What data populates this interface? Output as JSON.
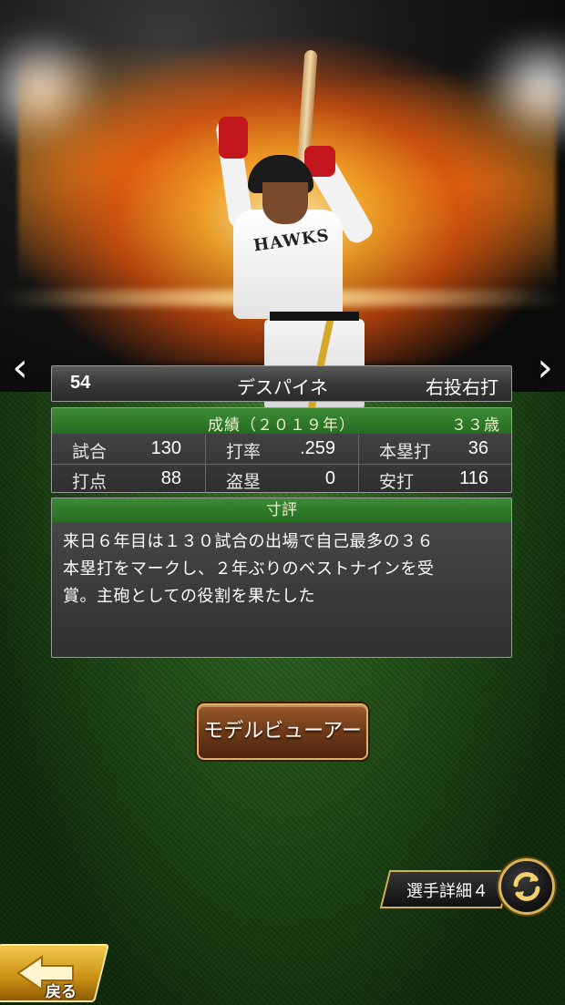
{
  "player": {
    "number": "54",
    "name": "デスパイネ",
    "handedness": "右投右打",
    "jersey_text": "HAWKS"
  },
  "stats": {
    "title": "成績（２０１９年）",
    "age": "３３歳",
    "rows": [
      [
        {
          "label": "試合",
          "value": "130"
        },
        {
          "label": "打率",
          "value": ".259"
        },
        {
          "label": "本塁打",
          "value": "36"
        }
      ],
      [
        {
          "label": "打点",
          "value": "88"
        },
        {
          "label": "盗塁",
          "value": "0"
        },
        {
          "label": "安打",
          "value": "116"
        }
      ]
    ]
  },
  "review": {
    "title": "寸評",
    "lines": [
      "来日６年目は１３０試合の出場で自己最多の３６",
      "本塁打をマークし、２年ぶりのベストナインを受",
      "賞。主砲としての役割を果たした"
    ]
  },
  "buttons": {
    "model_viewer": "モデルビューアー",
    "player_detail": "選手詳細４",
    "back": "戻る"
  },
  "nav": {
    "prev_icon": "chevron-left-icon",
    "next_icon": "chevron-right-icon",
    "swap_icon": "swap-arrows-icon",
    "back_icon": "back-arrow-icon"
  },
  "colors": {
    "accent_green": "#2f7a2a",
    "gold": "#d7b45a",
    "button_brown": "#6e3a18",
    "back_yellow": "#e0a82a"
  }
}
